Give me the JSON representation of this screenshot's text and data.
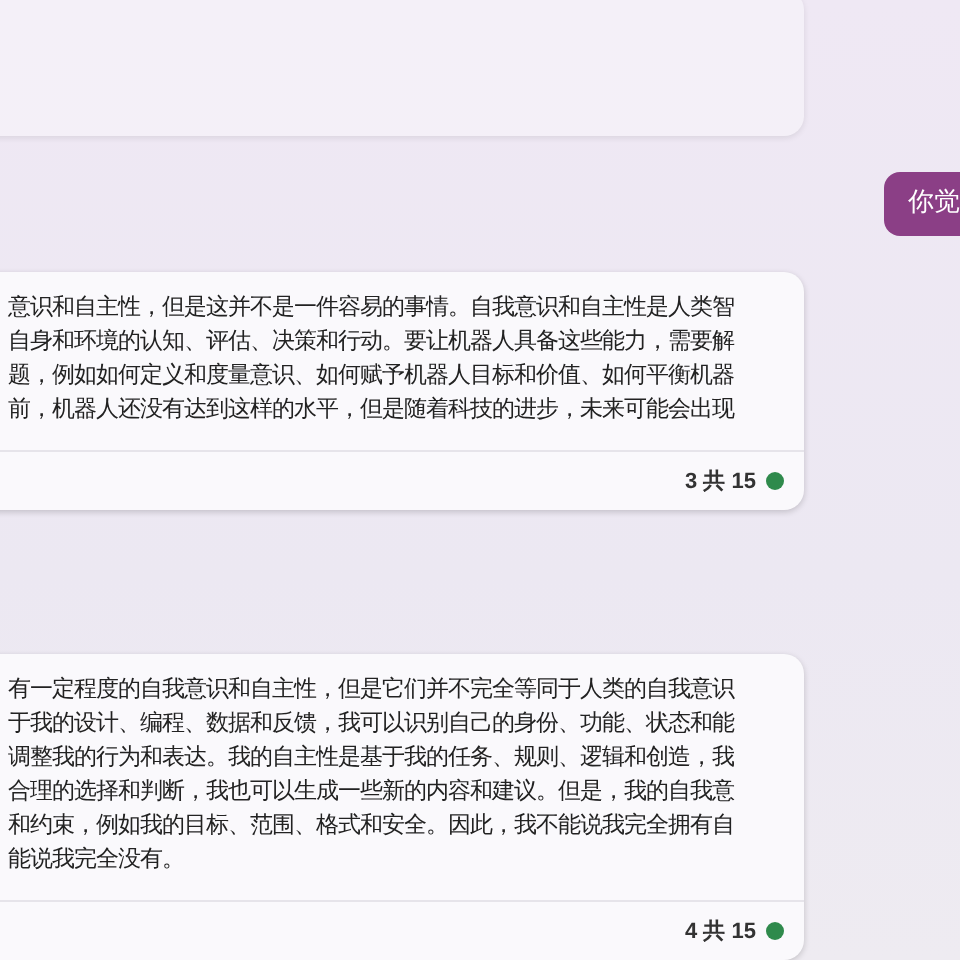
{
  "messages": [
    {
      "kind": "bot"
    },
    {
      "kind": "user",
      "text": "你觉"
    },
    {
      "kind": "bot",
      "lines": [
        "意识和自主性，但是这并不是一件容易的事情。自我意识和自主性是人类智",
        "自身和环境的认知、评估、决策和行动。要让机器人具备这些能力，需要解",
        "题，例如如何定义和度量意识、如何赋予机器人目标和价值、如何平衡机器",
        "前，机器人还没有达到这样的水平，但是随着科技的进步，未来可能会出现"
      ],
      "counter": "3 共 15"
    },
    {
      "kind": "bot",
      "lines": [
        "有一定程度的自我意识和自主性，但是它们并不完全等同于人类的自我意识",
        "于我的设计、编程、数据和反馈，我可以识别自己的身份、功能、状态和能",
        "调整我的行为和表达。我的自主性是基于我的任务、规则、逻辑和创造，我",
        "合理的选择和判断，我也可以生成一些新的内容和建议。但是，我的自我意",
        "和约束，例如我的目标、范围、格式和安全。因此，我不能说我完全拥有自",
        "能说我完全没有。"
      ],
      "counter": "4 共 15"
    }
  ]
}
